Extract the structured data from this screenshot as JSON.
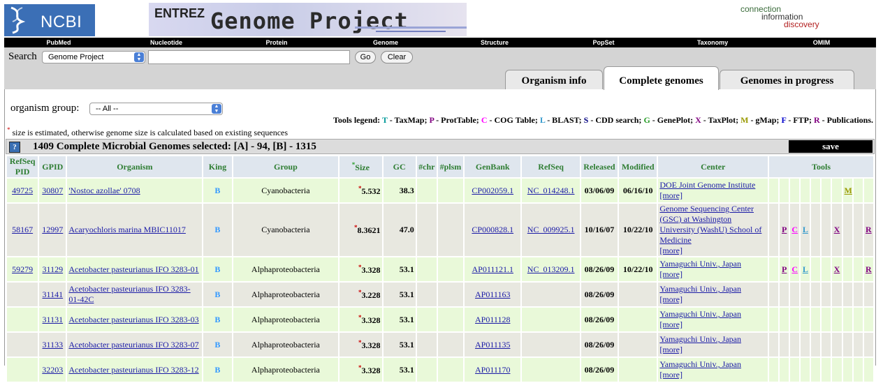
{
  "header": {
    "ncbi_logo": "NCBI",
    "banner_entrez": "ENTREZ",
    "banner_title": "Genome Project",
    "tagline": [
      "connection",
      "information",
      "discovery"
    ]
  },
  "nav": [
    "PubMed",
    "Nucleotide",
    "Protein",
    "Genome",
    "Structure",
    "PopSet",
    "Taxonomy",
    "OMIM"
  ],
  "search": {
    "label": "Search",
    "database": "Genome Project",
    "term": "",
    "go": "Go",
    "clear": "Clear"
  },
  "tabs": [
    {
      "label": "Organism info",
      "active": false
    },
    {
      "label": "Complete genomes",
      "active": true
    },
    {
      "label": "Genomes in progress",
      "active": false
    }
  ],
  "filter": {
    "label": "organism group:",
    "value": "-- All --"
  },
  "legend": {
    "title": "Tools legend:",
    "items": [
      {
        "key": "T",
        "desc": " - TaxMap;",
        "color": "#009999"
      },
      {
        "key": "P",
        "desc": " - ProtTable;",
        "color": "#800080"
      },
      {
        "key": "C",
        "desc": " - COG Table;",
        "color": "#ff00ff"
      },
      {
        "key": "L",
        "desc": " - BLAST;",
        "color": "#3399cc"
      },
      {
        "key": "S",
        "desc": " - CDD search;",
        "color": "#000080"
      },
      {
        "key": "G",
        "desc": " - GenePlot;",
        "color": "#2a9d2a"
      },
      {
        "key": "X",
        "desc": " - TaxPlot;",
        "color": "#800080"
      },
      {
        "key": "M",
        "desc": " - gMap;",
        "color": "#999900"
      },
      {
        "key": "F",
        "desc": " - FTP;",
        "color": "#0000cc"
      },
      {
        "key": "R",
        "desc": " - Publications.",
        "color": "#800080"
      }
    ]
  },
  "note": "size is estimated, otherwise genome size is calculated based on existing sequences",
  "selection": {
    "help": "?",
    "title": "1409 Complete Microbial Genomes selected: [A] - 94, [B] - 1315",
    "save": "save"
  },
  "columns": [
    "RefSeq PID",
    "GPID",
    "Organism",
    "King",
    "Group",
    "Size",
    "GC",
    "#chr",
    "#plsm",
    "GenBank",
    "RefSeq",
    "Released",
    "Modified",
    "Center",
    "Tools"
  ],
  "rows": [
    {
      "refseq_pid": "49725",
      "gpid": "30807",
      "organism": "'Nostoc azollae' 0708",
      "king": "B",
      "group": "Cyanobacteria",
      "size": "5.532",
      "gc": "38.3",
      "chr": "",
      "plsm": "",
      "genbank": "CP002059.1",
      "refseq": "NC_014248.1",
      "released": "03/06/09",
      "modified": "06/16/10",
      "center": "DOE Joint Genome Institute",
      "center_more": "[more]",
      "tools": [
        "",
        "",
        "",
        "",
        "",
        "",
        "",
        "M",
        "",
        ""
      ]
    },
    {
      "refseq_pid": "58167",
      "gpid": "12997",
      "organism": "Acaryochloris marina MBIC11017",
      "king": "B",
      "group": "Cyanobacteria",
      "size": "8.3621",
      "gc": "47.0",
      "chr": "",
      "plsm": "",
      "genbank": "CP000828.1",
      "refseq": "NC_009925.1",
      "released": "10/16/07",
      "modified": "10/22/10",
      "center": "Genome Sequencing Center (GSC) at Washington University (WashU) School of Medicine",
      "center_more": "[more]",
      "tools": [
        "",
        "P",
        "C",
        "L",
        "",
        "",
        "X",
        "",
        "",
        "R"
      ]
    },
    {
      "refseq_pid": "59279",
      "gpid": "31129",
      "organism": "Acetobacter pasteurianus IFO 3283-01",
      "king": "B",
      "group": "Alphaproteobacteria",
      "size": "3.328",
      "gc": "53.1",
      "chr": "",
      "plsm": "",
      "genbank": "AP011121.1",
      "refseq": "NC_013209.1",
      "released": "08/26/09",
      "modified": "10/22/10",
      "center": "Yamaguchi Univ., Japan",
      "center_more": "[more]",
      "tools": [
        "",
        "P",
        "C",
        "L",
        "",
        "",
        "X",
        "",
        "",
        "R"
      ]
    },
    {
      "refseq_pid": "",
      "gpid": "31141",
      "organism": "Acetobacter pasteurianus IFO 3283-01-42C",
      "king": "B",
      "group": "Alphaproteobacteria",
      "size": "3.228",
      "gc": "53.1",
      "chr": "",
      "plsm": "",
      "genbank": "AP011163",
      "refseq": "",
      "released": "08/26/09",
      "modified": "",
      "center": "Yamaguchi Univ., Japan",
      "center_more": "[more]",
      "tools": [
        "",
        "",
        "",
        "",
        "",
        "",
        "",
        "",
        "",
        ""
      ]
    },
    {
      "refseq_pid": "",
      "gpid": "31131",
      "organism": "Acetobacter pasteurianus IFO 3283-03",
      "king": "B",
      "group": "Alphaproteobacteria",
      "size": "3.328",
      "gc": "53.1",
      "chr": "",
      "plsm": "",
      "genbank": "AP011128",
      "refseq": "",
      "released": "08/26/09",
      "modified": "",
      "center": "Yamaguchi Univ., Japan",
      "center_more": "[more]",
      "tools": [
        "",
        "",
        "",
        "",
        "",
        "",
        "",
        "",
        "",
        ""
      ]
    },
    {
      "refseq_pid": "",
      "gpid": "31133",
      "organism": "Acetobacter pasteurianus IFO 3283-07",
      "king": "B",
      "group": "Alphaproteobacteria",
      "size": "3.328",
      "gc": "53.1",
      "chr": "",
      "plsm": "",
      "genbank": "AP011135",
      "refseq": "",
      "released": "08/26/09",
      "modified": "",
      "center": "Yamaguchi Univ., Japan",
      "center_more": "[more]",
      "tools": [
        "",
        "",
        "",
        "",
        "",
        "",
        "",
        "",
        "",
        ""
      ]
    },
    {
      "refseq_pid": "",
      "gpid": "32203",
      "organism": "Acetobacter pasteurianus IFO 3283-12",
      "king": "B",
      "group": "Alphaproteobacteria",
      "size": "3.328",
      "gc": "53.1",
      "chr": "",
      "plsm": "",
      "genbank": "AP011170",
      "refseq": "",
      "released": "08/26/09",
      "modified": "",
      "center": "Yamaguchi Univ., Japan",
      "center_more": "[more]",
      "tools": [
        "",
        "",
        "",
        "",
        "",
        "",
        "",
        "",
        "",
        ""
      ]
    }
  ]
}
